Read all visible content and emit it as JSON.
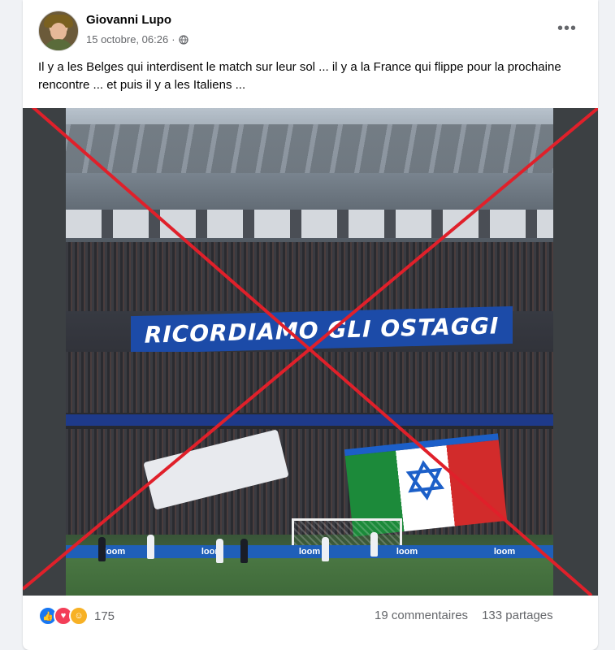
{
  "post": {
    "author": "Giovanni Lupo",
    "timestamp": "15 octobre, 06:26",
    "separator": "·",
    "privacy_icon": "globe-icon",
    "more_label": "•••",
    "text": "Il y a les Belges qui interdisent le match sur leur sol ... il y a la France qui flippe pour la prochaine rencontre ... et puis il y a les Italiens ..."
  },
  "image": {
    "banner_text": "RICORDIAMO GLI OSTAGGI",
    "ad_text": "loom",
    "overlay_icon": "red-cross-icon",
    "overlay_color": "#e0202a"
  },
  "footer": {
    "reaction_icons": [
      "like-reaction-icon",
      "love-reaction-icon",
      "care-reaction-icon"
    ],
    "reaction_count": "175",
    "comments": "19 commentaires",
    "shares": "133 partages"
  },
  "colors": {
    "background": "#f0f2f5",
    "like_blue": "#1877f2",
    "love_red": "#f33e58",
    "secondary_text": "#65676b"
  }
}
